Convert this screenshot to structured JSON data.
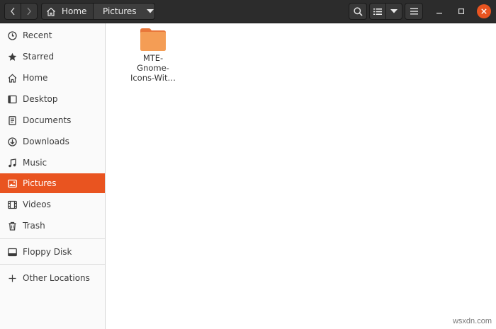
{
  "headerbar": {
    "back_icon": "chevron-left-icon",
    "forward_icon": "chevron-right-icon",
    "breadcrumbs": [
      {
        "label": "Home",
        "icon": "home-icon"
      },
      {
        "label": "Pictures",
        "icon": "dropdown-arrow-icon"
      }
    ],
    "tools": [
      "search-icon",
      "list-view-icon",
      "view-options-dropdown-icon",
      "hamburger-menu-icon"
    ],
    "window_controls": [
      "minimize-icon",
      "maximize-icon",
      "close-icon"
    ],
    "accent_color": "#e95420"
  },
  "sidebar": {
    "items": [
      {
        "label": "Recent",
        "icon": "clock-icon"
      },
      {
        "label": "Starred",
        "icon": "star-icon"
      },
      {
        "label": "Home",
        "icon": "home-icon"
      },
      {
        "label": "Desktop",
        "icon": "desktop-icon"
      },
      {
        "label": "Documents",
        "icon": "document-icon"
      },
      {
        "label": "Downloads",
        "icon": "download-icon"
      },
      {
        "label": "Music",
        "icon": "music-note-icon"
      },
      {
        "label": "Pictures",
        "icon": "image-icon",
        "active": true
      },
      {
        "label": "Videos",
        "icon": "film-icon"
      },
      {
        "label": "Trash",
        "icon": "trash-icon"
      }
    ],
    "devices": [
      {
        "label": "Floppy Disk",
        "icon": "drive-icon"
      }
    ],
    "other": {
      "label": "Other Locations",
      "icon": "plus-icon"
    }
  },
  "content": {
    "files": [
      {
        "name": "MTE-\nGnome-\nIcons-Wit…",
        "line1": "MTE-",
        "line2": "Gnome-",
        "line3": "Icons-Wit…",
        "icon": "folder-icon",
        "color": "#f49d55"
      }
    ]
  },
  "watermark": "wsxdn.com"
}
